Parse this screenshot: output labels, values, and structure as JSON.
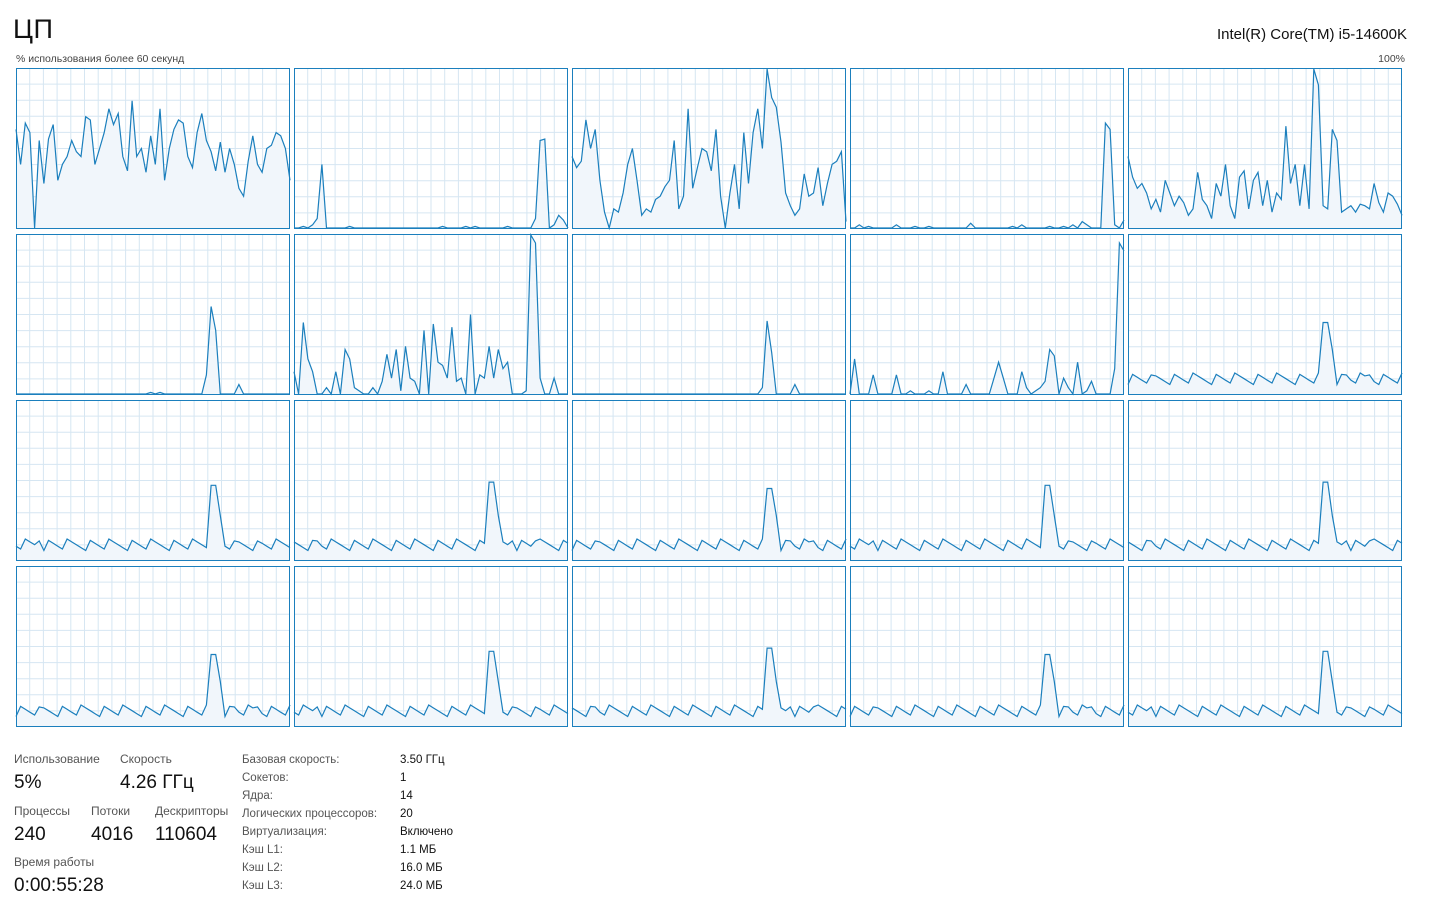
{
  "header": {
    "title": "ЦП",
    "cpu_name": "Intel(R) Core(TM) i5-14600K",
    "graph_caption": "% использования более 60 секунд",
    "graph_max": "100%"
  },
  "colors": {
    "line": "#1b7fbd",
    "fill": "#f1f6fb",
    "grid": "#d6e6f2",
    "border": "#1b7fbd"
  },
  "graphs": [
    [
      62,
      40,
      66,
      60,
      0,
      55,
      28,
      56,
      65,
      30,
      40,
      45,
      55,
      48,
      45,
      70,
      68,
      40,
      50,
      60,
      75,
      65,
      72,
      45,
      36,
      80,
      45,
      50,
      35,
      58,
      40,
      75,
      30,
      50,
      62,
      68,
      66,
      45,
      38,
      60,
      72,
      55,
      48,
      36,
      54,
      35,
      50,
      40,
      25,
      20,
      42,
      58,
      40,
      35,
      50,
      52,
      60,
      58,
      50,
      30
    ],
    [
      0,
      0,
      1,
      0,
      2,
      6,
      40,
      0,
      0,
      0,
      0,
      0,
      1,
      0,
      0,
      0,
      0,
      0,
      0,
      0,
      0,
      0,
      0,
      0,
      0,
      0,
      0,
      0,
      0,
      0,
      0,
      0,
      1,
      0,
      0,
      0,
      0,
      1,
      0,
      1,
      0,
      0,
      0,
      0,
      0,
      0,
      1,
      0,
      0,
      0,
      0,
      0,
      6,
      55,
      56,
      0,
      2,
      8,
      5,
      0
    ],
    [
      45,
      38,
      42,
      68,
      50,
      62,
      30,
      10,
      0,
      12,
      10,
      22,
      40,
      50,
      30,
      8,
      12,
      10,
      18,
      20,
      26,
      30,
      55,
      12,
      20,
      75,
      25,
      38,
      50,
      48,
      36,
      62,
      20,
      0,
      22,
      40,
      12,
      60,
      28,
      60,
      75,
      50,
      100,
      82,
      76,
      54,
      22,
      14,
      8,
      12,
      34,
      20,
      22,
      38,
      14,
      28,
      40,
      42,
      48,
      4
    ],
    [
      0,
      0,
      2,
      0,
      1,
      0,
      0,
      0,
      0,
      0,
      2,
      0,
      0,
      0,
      1,
      0,
      0,
      1,
      0,
      0,
      0,
      0,
      0,
      0,
      0,
      0,
      3,
      0,
      0,
      0,
      0,
      0,
      0,
      0,
      0,
      1,
      0,
      2,
      0,
      0,
      0,
      0,
      0,
      1,
      0,
      0,
      1,
      0,
      2,
      0,
      4,
      2,
      0,
      0,
      0,
      66,
      62,
      2,
      0,
      5
    ],
    [
      45,
      32,
      25,
      28,
      22,
      12,
      18,
      10,
      30,
      22,
      14,
      20,
      16,
      8,
      12,
      35,
      18,
      14,
      6,
      28,
      20,
      40,
      14,
      6,
      32,
      36,
      12,
      30,
      35,
      14,
      30,
      10,
      22,
      18,
      64,
      28,
      40,
      14,
      40,
      12,
      100,
      90,
      14,
      12,
      62,
      55,
      10,
      12,
      14,
      10,
      15,
      14,
      12,
      28,
      16,
      10,
      22,
      20,
      15,
      8
    ],
    [
      0,
      0,
      0,
      0,
      0,
      0,
      0,
      0,
      0,
      0,
      0,
      0,
      0,
      0,
      0,
      0,
      0,
      0,
      0,
      0,
      0,
      0,
      0,
      0,
      0,
      0,
      0,
      0,
      0,
      1,
      0,
      1,
      0,
      0,
      0,
      0,
      0,
      0,
      0,
      0,
      0,
      12,
      55,
      40,
      0,
      0,
      0,
      0,
      6,
      0,
      0,
      0,
      0,
      0,
      0,
      0,
      0,
      0,
      0,
      0
    ],
    [
      14,
      0,
      45,
      22,
      14,
      0,
      0,
      4,
      0,
      14,
      0,
      28,
      22,
      4,
      2,
      0,
      0,
      4,
      0,
      8,
      25,
      10,
      28,
      2,
      30,
      10,
      8,
      0,
      40,
      0,
      44,
      20,
      18,
      10,
      42,
      8,
      10,
      0,
      50,
      0,
      12,
      10,
      30,
      10,
      28,
      16,
      20,
      0,
      0,
      0,
      2,
      100,
      95,
      10,
      0,
      0,
      10,
      0,
      0,
      0
    ],
    [
      0,
      0,
      0,
      0,
      0,
      0,
      0,
      0,
      0,
      0,
      0,
      0,
      0,
      0,
      0,
      0,
      0,
      0,
      0,
      0,
      0,
      0,
      0,
      0,
      0,
      0,
      0,
      0,
      0,
      0,
      0,
      0,
      0,
      0,
      0,
      0,
      0,
      0,
      0,
      0,
      0,
      4,
      46,
      26,
      0,
      0,
      0,
      0,
      6,
      0,
      0,
      0,
      0,
      0,
      0,
      0,
      0,
      0,
      0,
      0
    ],
    [
      0,
      22,
      0,
      0,
      0,
      12,
      0,
      0,
      0,
      0,
      12,
      0,
      0,
      2,
      0,
      0,
      0,
      2,
      0,
      0,
      14,
      0,
      0,
      0,
      0,
      6,
      0,
      0,
      0,
      0,
      0,
      10,
      20,
      10,
      0,
      0,
      0,
      14,
      4,
      0,
      2,
      4,
      8,
      28,
      24,
      0,
      10,
      4,
      0,
      20,
      0,
      2,
      8,
      0,
      0,
      0,
      0,
      16,
      95,
      90
    ],
    [
      0,
      0,
      0,
      0,
      0,
      0,
      0,
      0,
      0,
      0,
      0,
      0,
      0,
      0,
      0,
      0,
      0,
      0,
      0,
      0,
      0,
      0,
      0,
      0,
      0,
      0,
      0,
      0,
      0,
      0,
      0,
      0,
      0,
      0,
      0,
      0,
      0,
      0,
      0,
      0,
      0,
      0,
      0,
      0,
      0,
      0,
      0,
      0,
      0,
      0,
      0,
      0,
      0,
      0,
      0,
      0,
      0,
      0,
      0,
      0
    ],
    [
      0,
      0,
      0,
      0,
      0,
      0,
      0,
      0,
      0,
      0,
      0,
      0,
      0,
      0,
      0,
      0,
      0,
      0,
      0,
      0,
      0,
      0,
      0,
      0,
      0,
      0,
      0,
      0,
      0,
      0,
      0,
      0,
      0,
      0,
      0,
      0,
      0,
      0,
      0,
      0,
      0,
      0,
      0,
      0,
      0,
      0,
      0,
      0,
      0,
      0,
      0,
      0,
      0,
      0,
      0,
      0,
      0,
      0,
      0,
      0
    ],
    [
      0,
      0,
      0,
      0,
      0,
      0,
      0,
      0,
      0,
      0,
      0,
      0,
      0,
      0,
      0,
      0,
      0,
      0,
      0,
      0,
      0,
      0,
      0,
      0,
      0,
      0,
      0,
      0,
      0,
      0,
      0,
      0,
      0,
      0,
      0,
      0,
      0,
      0,
      0,
      0,
      0,
      0,
      0,
      0,
      0,
      0,
      0,
      0,
      0,
      0,
      0,
      0,
      0,
      0,
      0,
      0,
      0,
      0,
      0,
      0
    ],
    [
      0,
      0,
      0,
      0,
      0,
      0,
      0,
      0,
      0,
      0,
      0,
      0,
      0,
      0,
      0,
      0,
      0,
      0,
      0,
      0,
      0,
      0,
      0,
      0,
      0,
      0,
      0,
      0,
      0,
      0,
      0,
      0,
      0,
      0,
      0,
      0,
      0,
      0,
      0,
      0,
      0,
      0,
      0,
      0,
      0,
      0,
      0,
      0,
      0,
      0,
      0,
      0,
      0,
      0,
      0,
      0,
      0,
      0,
      0,
      0
    ],
    [
      0,
      0,
      0,
      0,
      0,
      0,
      0,
      0,
      0,
      0,
      0,
      0,
      0,
      0,
      0,
      0,
      0,
      0,
      0,
      0,
      0,
      0,
      0,
      0,
      0,
      0,
      0,
      0,
      0,
      0,
      0,
      0,
      0,
      0,
      0,
      0,
      0,
      0,
      0,
      0,
      0,
      0,
      0,
      0,
      0,
      0,
      0,
      0,
      0,
      0,
      0,
      0,
      0,
      0,
      0,
      0,
      0,
      0,
      0,
      0
    ],
    [
      0,
      0,
      0,
      0,
      0,
      0,
      0,
      0,
      0,
      0,
      0,
      0,
      0,
      0,
      0,
      0,
      0,
      0,
      0,
      0,
      0,
      0,
      0,
      0,
      0,
      0,
      0,
      0,
      0,
      0,
      0,
      0,
      0,
      0,
      0,
      0,
      0,
      0,
      0,
      0,
      0,
      0,
      0,
      0,
      0,
      0,
      0,
      0,
      0,
      0,
      0,
      0,
      0,
      0,
      0,
      0,
      0,
      0,
      0,
      0
    ],
    [
      0,
      0,
      0,
      0,
      0,
      0,
      0,
      0,
      0,
      0,
      0,
      0,
      0,
      0,
      0,
      0,
      0,
      0,
      0,
      0,
      0,
      0,
      0,
      0,
      0,
      0,
      0,
      0,
      0,
      0,
      0,
      0,
      0,
      0,
      0,
      0,
      0,
      0,
      0,
      0,
      0,
      0,
      0,
      0,
      0,
      0,
      0,
      0,
      0,
      0,
      0,
      0,
      0,
      0,
      0,
      0,
      0,
      0,
      0,
      0
    ],
    [
      0,
      0,
      0,
      0,
      0,
      0,
      0,
      0,
      0,
      0,
      0,
      0,
      0,
      0,
      0,
      0,
      0,
      0,
      0,
      0,
      0,
      0,
      0,
      0,
      0,
      0,
      0,
      0,
      0,
      0,
      0,
      0,
      0,
      0,
      0,
      0,
      0,
      0,
      0,
      0,
      0,
      0,
      0,
      0,
      0,
      0,
      0,
      0,
      0,
      0,
      0,
      0,
      0,
      0,
      0,
      0,
      0,
      0,
      0,
      0
    ],
    [
      0,
      0,
      0,
      0,
      0,
      0,
      0,
      0,
      0,
      0,
      0,
      0,
      0,
      0,
      0,
      0,
      0,
      0,
      0,
      0,
      0,
      0,
      0,
      0,
      0,
      0,
      0,
      0,
      0,
      0,
      0,
      0,
      0,
      0,
      0,
      0,
      0,
      0,
      0,
      0,
      0,
      0,
      0,
      0,
      0,
      0,
      0,
      0,
      0,
      0,
      0,
      0,
      0,
      0,
      0,
      0,
      0,
      0,
      0,
      0
    ],
    [
      0,
      0,
      0,
      0,
      0,
      0,
      0,
      0,
      0,
      0,
      0,
      0,
      0,
      0,
      0,
      0,
      0,
      0,
      0,
      0,
      0,
      0,
      0,
      0,
      0,
      0,
      0,
      0,
      0,
      0,
      0,
      0,
      0,
      0,
      0,
      0,
      0,
      0,
      0,
      0,
      0,
      0,
      0,
      0,
      0,
      0,
      0,
      0,
      0,
      0,
      0,
      0,
      0,
      0,
      0,
      0,
      0,
      0,
      0,
      0
    ],
    [
      0,
      0,
      0,
      0,
      0,
      0,
      0,
      0,
      0,
      0,
      0,
      0,
      0,
      0,
      0,
      0,
      0,
      0,
      0,
      0,
      0,
      0,
      0,
      0,
      0,
      0,
      0,
      0,
      0,
      0,
      0,
      0,
      0,
      0,
      0,
      0,
      0,
      0,
      0,
      0,
      0,
      0,
      0,
      0,
      0,
      0,
      0,
      0,
      0,
      0,
      0,
      0,
      0,
      0,
      0,
      0,
      0,
      0,
      0,
      0
    ]
  ],
  "stats": {
    "usage_label": "Использование",
    "usage_value": "5%",
    "speed_label": "Скорость",
    "speed_value": "4.26 ГГц",
    "processes_label": "Процессы",
    "processes_value": "240",
    "threads_label": "Потоки",
    "threads_value": "4016",
    "handles_label": "Дескрипторы",
    "handles_value": "110604",
    "uptime_label": "Время работы",
    "uptime_value": "0:00:55:28"
  },
  "info": [
    {
      "key": "Базовая скорость:",
      "value": "3.50 ГГц"
    },
    {
      "key": "Сокетов:",
      "value": "1"
    },
    {
      "key": "Ядра:",
      "value": "14"
    },
    {
      "key": "Логических процессоров:",
      "value": "20"
    },
    {
      "key": "Виртуализация:",
      "value": "Включено"
    },
    {
      "key": "Кэш L1:",
      "value": "1.1 МБ"
    },
    {
      "key": "Кэш L2:",
      "value": "16.0 МБ"
    },
    {
      "key": "Кэш L3:",
      "value": "24.0 МБ"
    }
  ]
}
